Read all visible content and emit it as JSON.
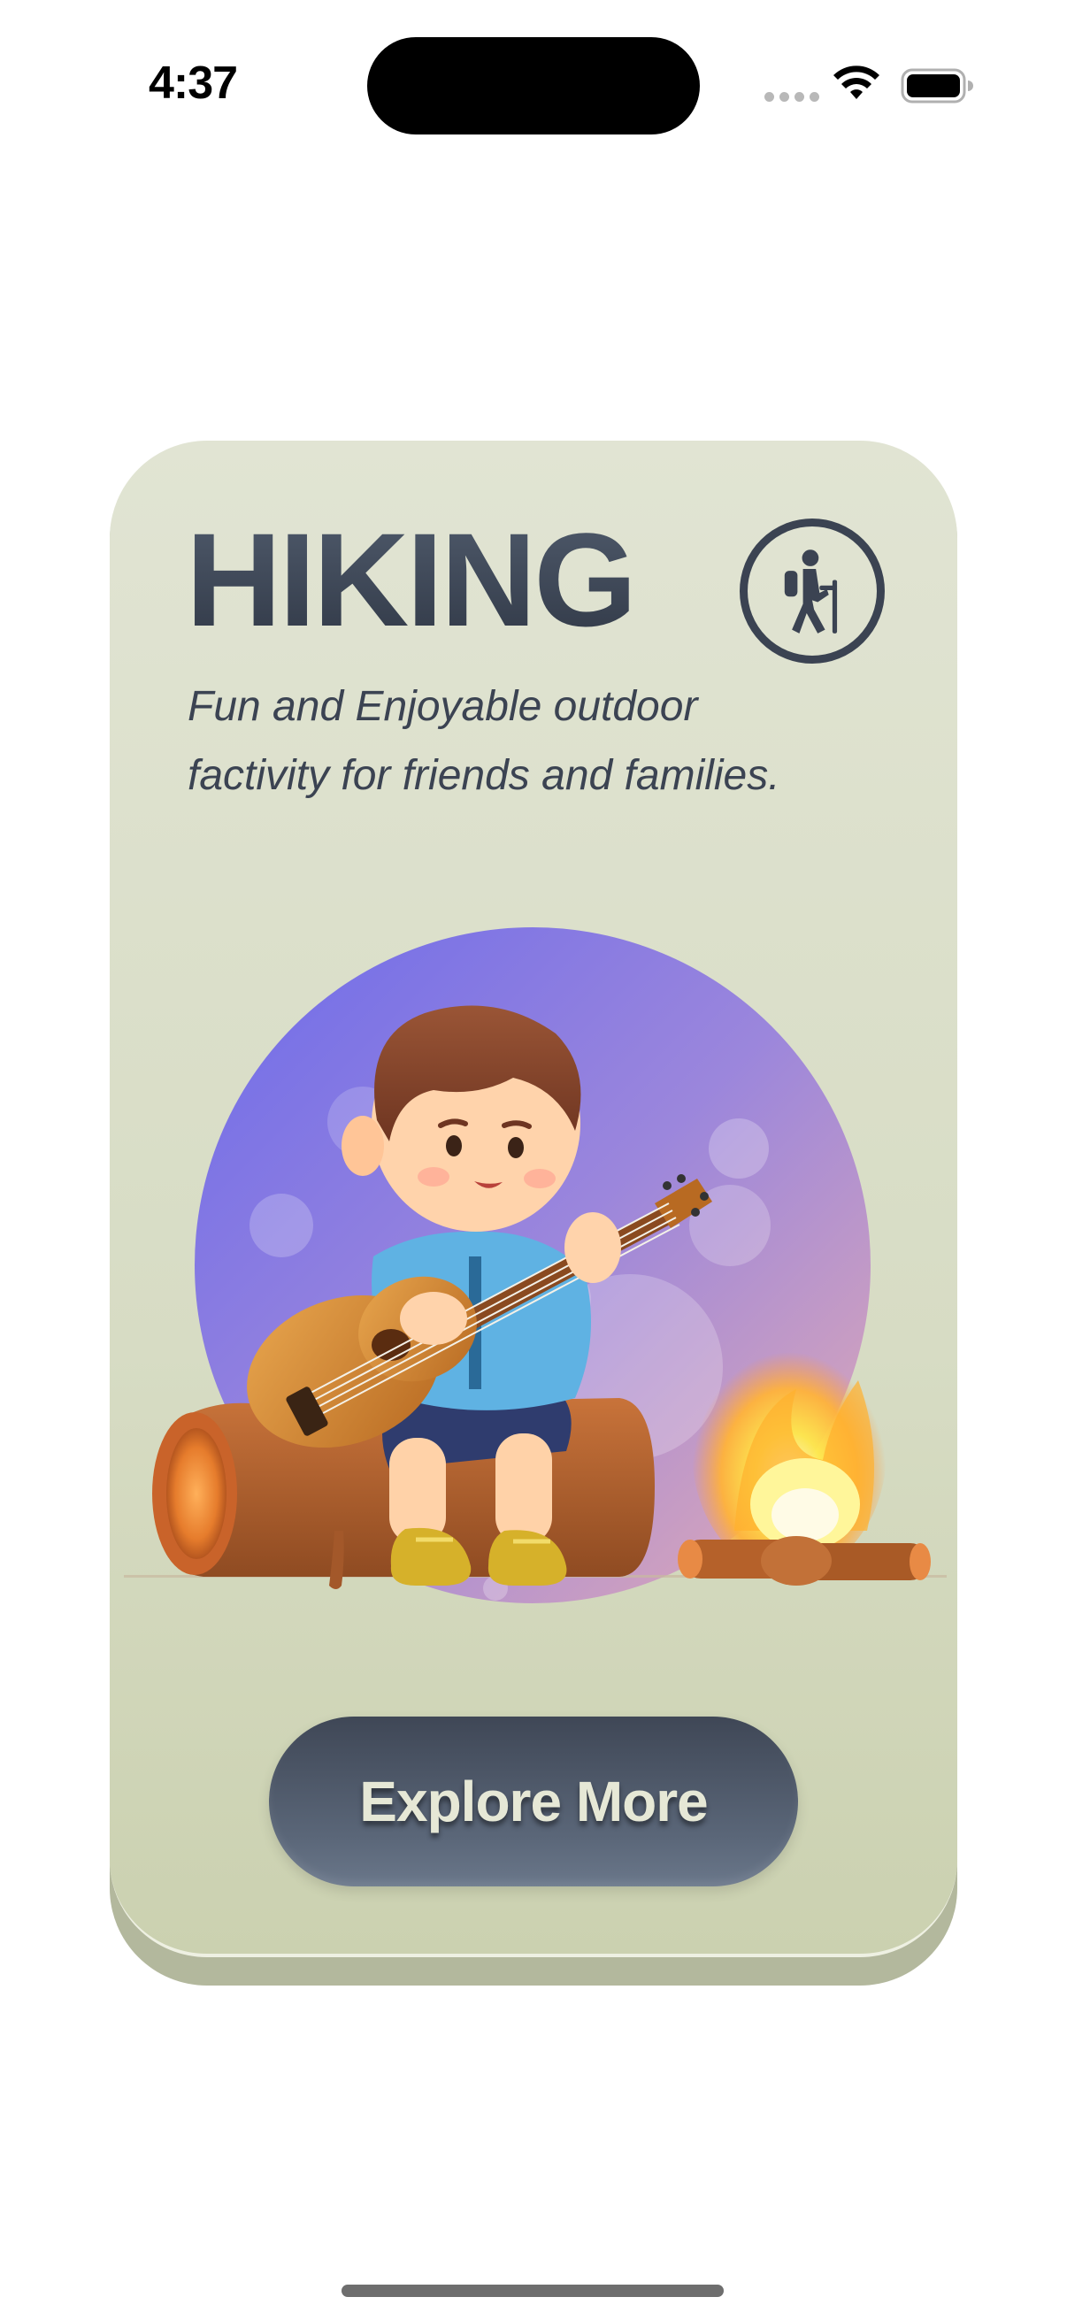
{
  "status_bar": {
    "time": "4:37",
    "icons": [
      "signal-dots-icon",
      "wifi-icon",
      "battery-icon"
    ]
  },
  "card": {
    "title": "HIKING",
    "badge_icon": "hiker-icon",
    "subtitle_line1": "Fun and Enjoyable outdoor",
    "subtitle_line2": "factivity for friends and families.",
    "illustration": "boy-playing-guitar-on-log-by-campfire",
    "cta_label": "Explore More"
  },
  "colors": {
    "card_background": "#dadfc9",
    "title": "#3b4352",
    "button": "#4e5868",
    "button_text": "#e6e8d6",
    "accent_purple": "#7b74e6",
    "accent_pink": "#e0a7b8"
  }
}
